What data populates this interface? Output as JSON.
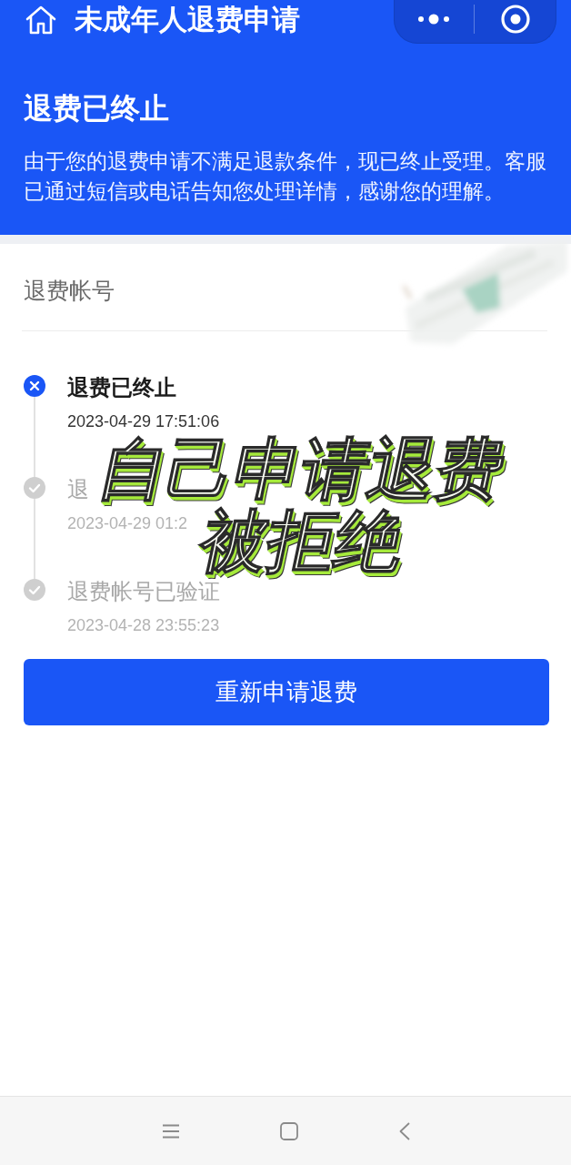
{
  "header": {
    "title": "未成年人退费申请"
  },
  "status": {
    "title": "退费已终止",
    "message": "由于您的退费申请不满足退款条件，现已终止受理。客服已通过短信或电话告知您处理详情，感谢您的理解。"
  },
  "account": {
    "label": "退费帐号"
  },
  "timeline": [
    {
      "kind": "terminated",
      "active": true,
      "title": "退费已终止",
      "time": "2023-04-29 17:51:06"
    },
    {
      "kind": "done",
      "active": false,
      "title": "退",
      "time": "2023-04-29 01:2"
    },
    {
      "kind": "done",
      "active": false,
      "title": "退费帐号已验证",
      "time": "2023-04-28 23:55:23"
    }
  ],
  "button": {
    "label": "重新申请退费"
  },
  "overlay_caption": [
    "自己申请退费",
    "被拒绝"
  ]
}
